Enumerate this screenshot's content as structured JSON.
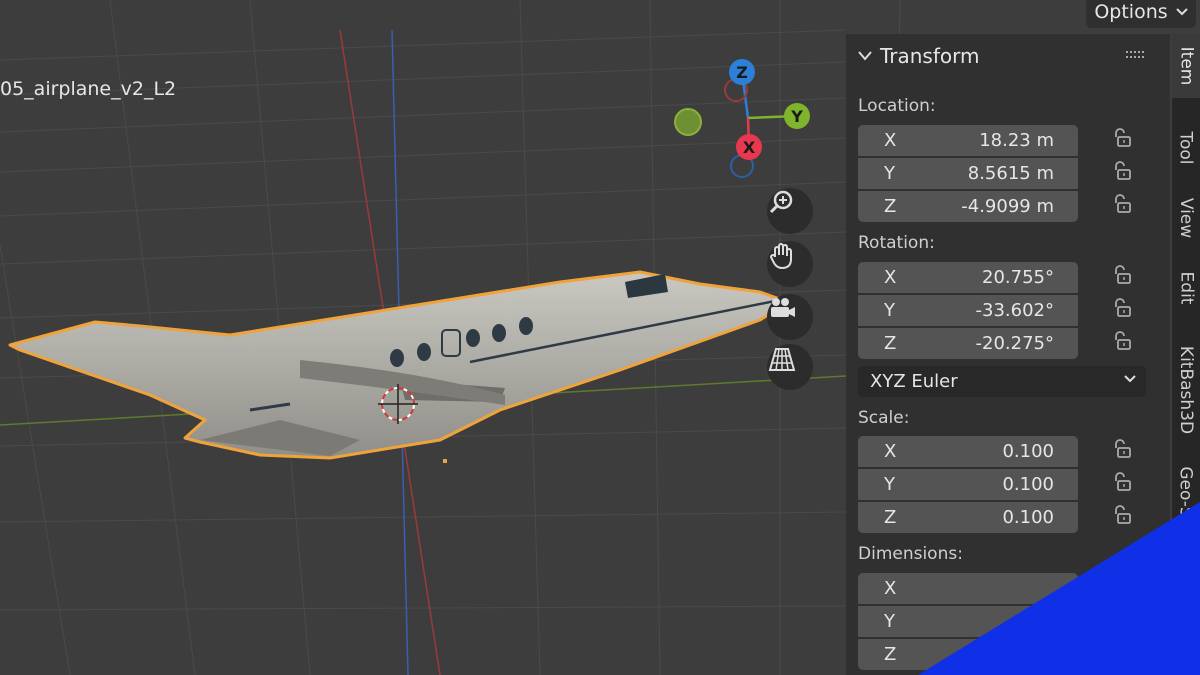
{
  "header": {
    "options_label": "Options"
  },
  "viewport": {
    "object_name": "05_airplane_v2_L2",
    "gizmo": {
      "x_label": "X",
      "y_label": "Y",
      "z_label": "Z"
    },
    "nav_buttons": [
      "zoom-icon",
      "pan-hand-icon",
      "camera-icon",
      "grid-perspective-icon"
    ]
  },
  "panel": {
    "title": "Transform",
    "location": {
      "label": "Location:",
      "rows": [
        {
          "axis": "X",
          "value": "18.23 m"
        },
        {
          "axis": "Y",
          "value": "8.5615 m"
        },
        {
          "axis": "Z",
          "value": "-4.9099 m"
        }
      ]
    },
    "rotation": {
      "label": "Rotation:",
      "rows": [
        {
          "axis": "X",
          "value": "20.755°"
        },
        {
          "axis": "Y",
          "value": "-33.602°"
        },
        {
          "axis": "Z",
          "value": "-20.275°"
        }
      ],
      "mode": "XYZ Euler"
    },
    "scale": {
      "label": "Scale:",
      "rows": [
        {
          "axis": "X",
          "value": "0.100"
        },
        {
          "axis": "Y",
          "value": "0.100"
        },
        {
          "axis": "Z",
          "value": "0.100"
        }
      ]
    },
    "dimensions": {
      "label": "Dimensions:",
      "rows": [
        {
          "axis": "X",
          "value": ""
        },
        {
          "axis": "Y",
          "value": ""
        },
        {
          "axis": "Z",
          "value": ""
        }
      ]
    }
  },
  "tabs": [
    "Item",
    "Tool",
    "View",
    "Edit",
    "KitBash3D",
    "Geo-S"
  ],
  "colors": {
    "selection_outline": "#f0a33a",
    "axis_x": "#e8384f",
    "axis_y": "#7fb42d",
    "axis_z": "#2c80d8",
    "corner_accent": "#1030e8"
  }
}
